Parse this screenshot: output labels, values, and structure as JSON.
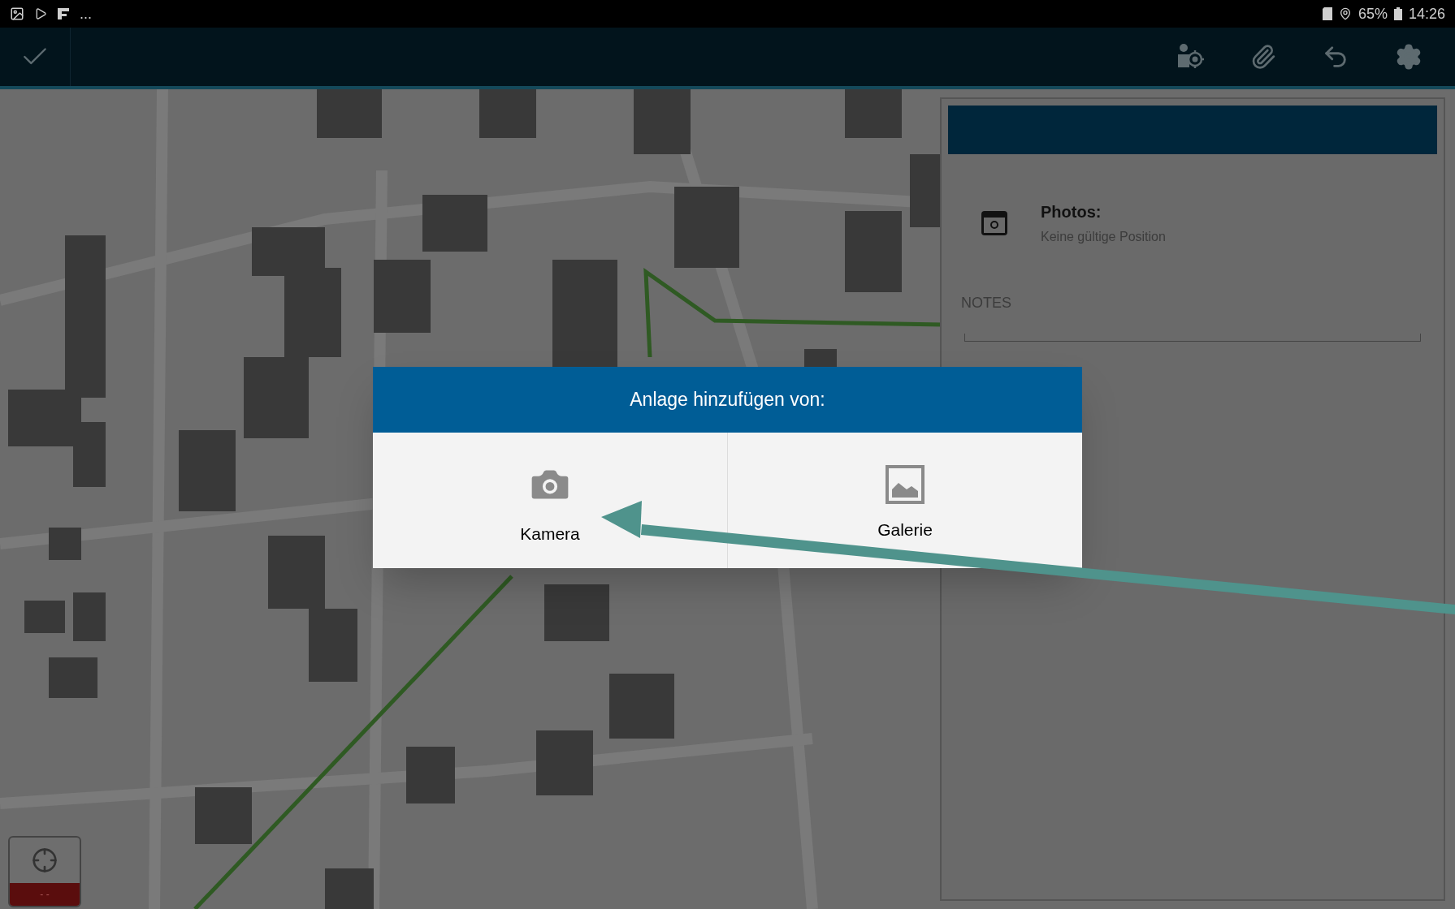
{
  "status_bar": {
    "overflow": "...",
    "battery": "65%",
    "time": "14:26"
  },
  "panel": {
    "photos": {
      "title": "Photos:",
      "subtitle": "Keine gültige Position"
    },
    "notes": {
      "label": "NOTES"
    }
  },
  "dialog": {
    "title": "Anlage hinzufügen von:",
    "options": [
      {
        "kind": "camera",
        "label": "Kamera"
      },
      {
        "kind": "gallery",
        "label": "Galerie"
      }
    ]
  },
  "location_button": {
    "reading": "- -"
  }
}
